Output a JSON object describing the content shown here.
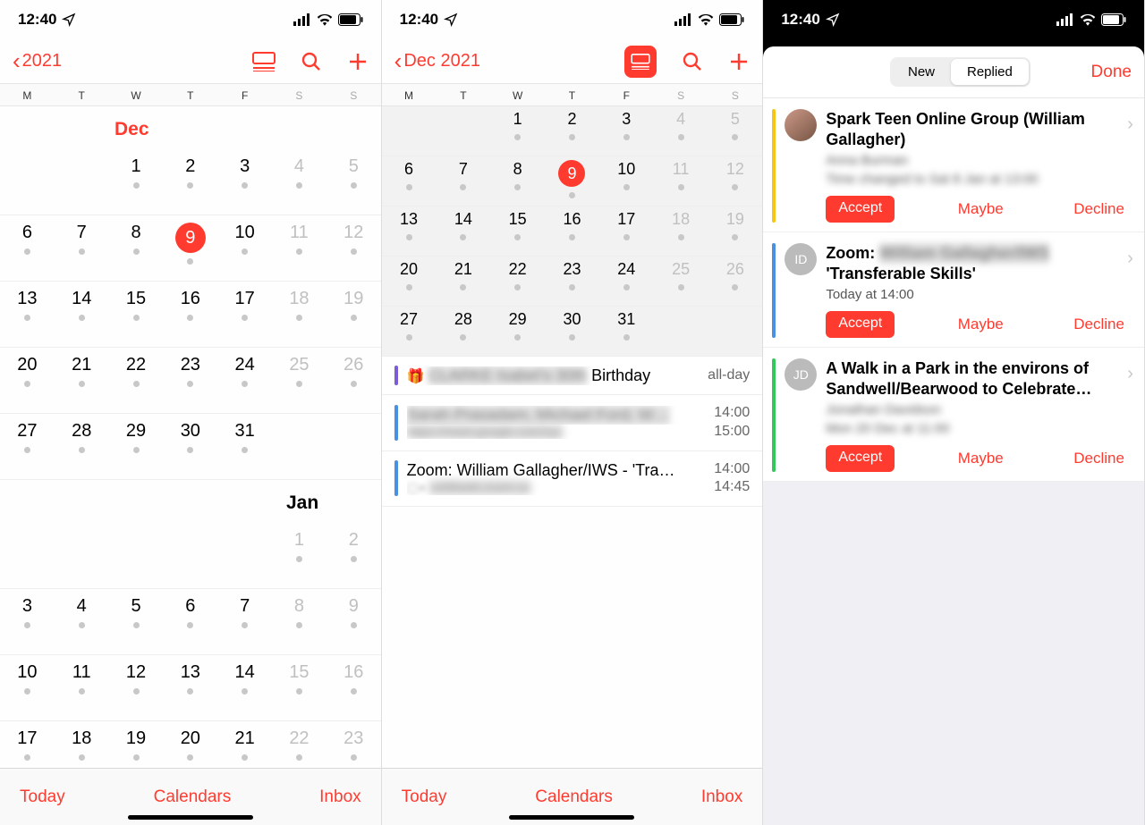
{
  "status": {
    "time": "12:40"
  },
  "weekdays": [
    "M",
    "T",
    "W",
    "T",
    "F",
    "S",
    "S"
  ],
  "screen1": {
    "back": "2021",
    "month1": "Dec",
    "month2": "Jan",
    "toolbar": {
      "today": "Today",
      "calendars": "Calendars",
      "inbox": "Inbox"
    },
    "decGrid": [
      [
        null,
        null,
        "1",
        "2",
        "3",
        "4",
        "5"
      ],
      [
        "6",
        "7",
        "8",
        "9",
        "10",
        "11",
        "12"
      ],
      [
        "13",
        "14",
        "15",
        "16",
        "17",
        "18",
        "19"
      ],
      [
        "20",
        "21",
        "22",
        "23",
        "24",
        "25",
        "26"
      ],
      [
        "27",
        "28",
        "29",
        "30",
        "31",
        null,
        null
      ]
    ],
    "janGrid": [
      [
        null,
        null,
        null,
        null,
        null,
        "1",
        "2"
      ],
      [
        "3",
        "4",
        "5",
        "6",
        "7",
        "8",
        "9"
      ],
      [
        "10",
        "11",
        "12",
        "13",
        "14",
        "15",
        "16"
      ],
      [
        "17",
        "18",
        "19",
        "20",
        "21",
        "22",
        "23"
      ]
    ],
    "todayNum": "9"
  },
  "screen2": {
    "back": "Dec 2021",
    "grid": [
      [
        null,
        null,
        "1",
        "2",
        "3",
        "4",
        "5"
      ],
      [
        "6",
        "7",
        "8",
        "9",
        "10",
        "11",
        "12"
      ],
      [
        "13",
        "14",
        "15",
        "16",
        "17",
        "18",
        "19"
      ],
      [
        "20",
        "21",
        "22",
        "23",
        "24",
        "25",
        "26"
      ],
      [
        "27",
        "28",
        "29",
        "30",
        "31",
        null,
        null
      ]
    ],
    "todayNum": "9",
    "events": [
      {
        "bar": "purple",
        "icon": "gift",
        "title": "Birthday",
        "blurredPrefix": "CLARKE Isabel's 30th",
        "time1": "all-day",
        "time2": ""
      },
      {
        "bar": "blue",
        "title": "Sarah Prasadam, Michael Ford, W…",
        "blurred": true,
        "sub": "https://meet.google.com/xyz",
        "time1": "14:00",
        "time2": "15:00"
      },
      {
        "bar": "blue",
        "title": "Zoom: William Gallagher/IWS - 'Tra…",
        "sub": "us06web.zoom.us",
        "subIcon": "video",
        "time1": "14:00",
        "time2": "14:45"
      }
    ],
    "toolbar": {
      "today": "Today",
      "calendars": "Calendars",
      "inbox": "Inbox"
    }
  },
  "screen3": {
    "segmented": {
      "new": "New",
      "replied": "Replied"
    },
    "done": "Done",
    "actions": {
      "accept": "Accept",
      "maybe": "Maybe",
      "decline": "Decline"
    },
    "invites": [
      {
        "stripe": "yellow",
        "avatar": "img",
        "title": "Spark Teen Online Group (William Gallagher)",
        "sub": "Anna Burman",
        "sub2": "Time changed to Sat 8 Jan at 13:00"
      },
      {
        "stripe": "blue",
        "avatar": "ID",
        "title": "Zoom:",
        "titleBlur": "William Gallagher/IWS",
        "title2": "'Transferable Skills'",
        "sub": "Today at 14:00"
      },
      {
        "stripe": "green",
        "avatar": "JD",
        "title": "A Walk in a Park in the environs of Sandwell/Bearwood to Celebrate…",
        "sub": "Jonathan Davidson",
        "sub2": "Mon 20 Dec at 11:00"
      }
    ]
  }
}
